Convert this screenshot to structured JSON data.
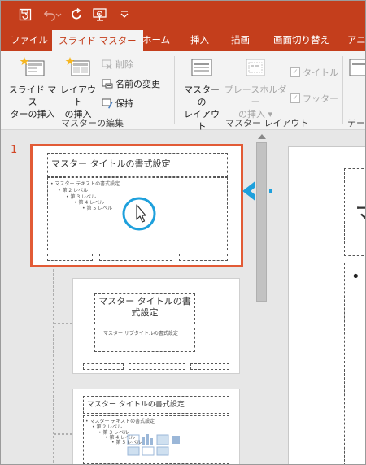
{
  "quick_access": {
    "icons": [
      "save-icon",
      "undo-icon",
      "redo-icon",
      "start-slideshow-icon",
      "customize-qat-icon"
    ]
  },
  "tabs": [
    {
      "label": "ファイル",
      "active": false
    },
    {
      "label": "スライド マスター",
      "active": true
    },
    {
      "label": "ホーム",
      "active": false
    },
    {
      "label": "挿入",
      "active": false
    },
    {
      "label": "描画",
      "active": false
    },
    {
      "label": "画面切り替え",
      "active": false
    },
    {
      "label": "アニメ",
      "active": false
    }
  ],
  "ribbon": {
    "insert_master": {
      "line1": "スライド マス",
      "line2": "ターの挿入"
    },
    "insert_layout": {
      "line1": "レイアウト",
      "line2": "の挿入"
    },
    "delete": "削除",
    "rename": "名前の変更",
    "preserve": "保持",
    "group_master_edit": "マスターの編集",
    "master_layout": {
      "line1": "マスターの",
      "line2": "レイアウト"
    },
    "insert_placeholder": {
      "line1": "プレースホルダー",
      "line2": "の挿入"
    },
    "title_check": "タイトル",
    "footer_check": "フッター",
    "group_master_layout": "マスター レイアウト",
    "group_theme": "テー"
  },
  "slides": {
    "number": "1",
    "master_title": "マスター タイトルの書式設定",
    "text_levels": [
      "マスター テキストの書式設定",
      "第 2 レベル",
      "第 3 レベル",
      "第 4 レベル",
      "第 5 レベル"
    ],
    "layout_title": "マスター タイトルの書式設定",
    "layout_subtitle": "マスター サブタイトルの書式設定",
    "layout3_title": "マスター タイトルの書式設定"
  },
  "main_slide": {
    "title_fragment": "マ",
    "bullet": "•"
  },
  "colors": {
    "brand": "#c43e1c",
    "selection": "#e25b36",
    "arrow": "#1ea0dc",
    "cursor_circle": "#1ea0dc"
  }
}
